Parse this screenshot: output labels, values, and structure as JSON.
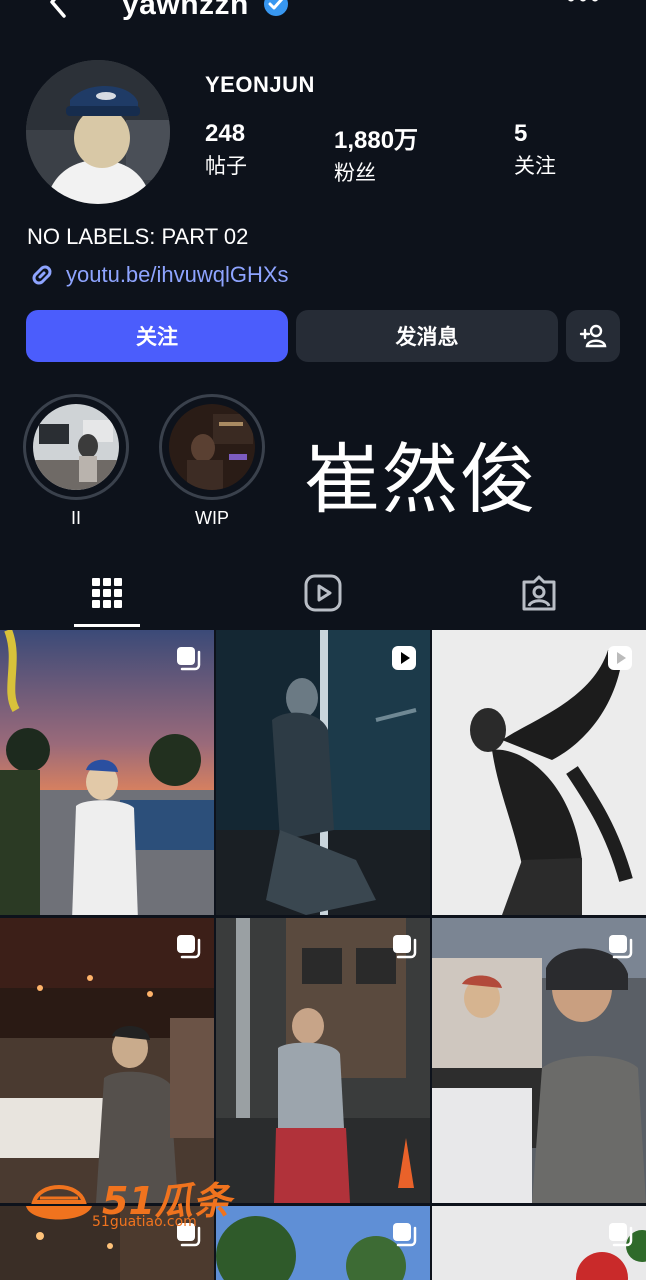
{
  "header": {
    "username": "yawnzzn",
    "verified_icon": "verified-badge-icon",
    "back_icon": "chevron-left-icon",
    "more_icon": "more-horizontal-icon"
  },
  "profile": {
    "display_name": "YEONJUN",
    "stats": [
      {
        "value": "248",
        "label": "帖子"
      },
      {
        "value": "1,880万",
        "label": "粉丝"
      },
      {
        "value": "5",
        "label": "关注"
      }
    ],
    "bio": "NO LABELS: PART 02",
    "link": "youtu.be/ihvuwqlGHXs"
  },
  "actions": {
    "follow": "关注",
    "message": "发消息",
    "add_user_icon": "add-user-icon"
  },
  "highlights": [
    {
      "label": "II"
    },
    {
      "label": "WIP"
    }
  ],
  "overlay_text": "崔然俊",
  "tabs": {
    "grid_icon": "grid-icon",
    "reels_icon": "reels-icon",
    "tagged_icon": "tagged-icon"
  },
  "watermark": {
    "brand": "51瓜条",
    "domain": "51guatiao.com"
  },
  "colors": {
    "background": "#0d121b",
    "follow_button": "#4b5dfc",
    "secondary_button": "#262c36",
    "link": "#8ea4ff",
    "verified": "#3897f0",
    "watermark": "#f0731e"
  }
}
